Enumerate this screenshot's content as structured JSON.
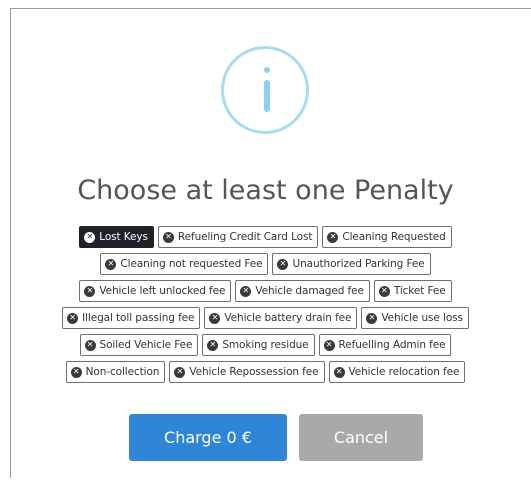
{
  "dialog": {
    "title": "Choose at least one Penalty"
  },
  "penalties": [
    {
      "label": "Lost Keys",
      "selected": true
    },
    {
      "label": "Refueling Credit Card Lost",
      "selected": false
    },
    {
      "label": "Cleaning Requested",
      "selected": false
    },
    {
      "label": "Cleaning not requested Fee",
      "selected": false
    },
    {
      "label": "Unauthorized Parking Fee",
      "selected": false
    },
    {
      "label": "Vehicle left unlocked fee",
      "selected": false
    },
    {
      "label": "Vehicle damaged fee",
      "selected": false
    },
    {
      "label": "Ticket Fee",
      "selected": false
    },
    {
      "label": "Illegal toll passing fee",
      "selected": false
    },
    {
      "label": "Vehicle battery drain fee",
      "selected": false
    },
    {
      "label": "Vehicle use loss",
      "selected": false
    },
    {
      "label": "Soiled Vehicle Fee",
      "selected": false
    },
    {
      "label": "Smoking residue",
      "selected": false
    },
    {
      "label": "Refuelling Admin fee",
      "selected": false
    },
    {
      "label": "Non-collection",
      "selected": false
    },
    {
      "label": "Vehicle Repossession fee",
      "selected": false
    },
    {
      "label": "Vehicle relocation fee",
      "selected": false
    }
  ],
  "buttons": {
    "charge_label": "Charge 0 €",
    "cancel_label": "Cancel"
  },
  "colors": {
    "accent": "#2f86d6",
    "cancel": "#a9a9a9",
    "selected_tag": "#1f2329",
    "info_icon": "#a6dcf1"
  },
  "icons": {
    "header": "info-icon",
    "tag_remove": "close-circle-icon"
  }
}
